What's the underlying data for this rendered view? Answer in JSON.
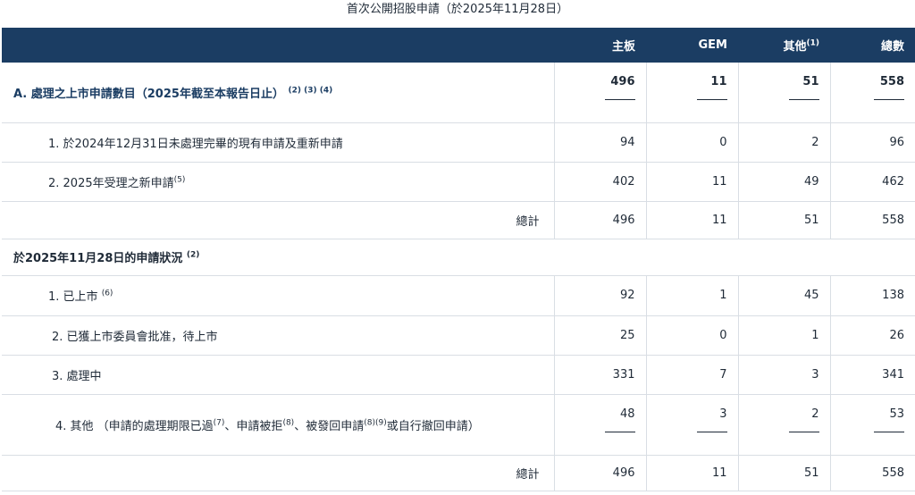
{
  "title": "首次公開招股申請（於2025年11月28日）",
  "header": {
    "col_main": "主板",
    "col_gem": "GEM",
    "col_other": "其他",
    "col_other_note": "(1)",
    "col_total": "總數"
  },
  "section_a": {
    "label": "A. 處理之上市申請數目（2025年截至本報告日止）",
    "notes": "(2) (3) (4)",
    "main": "496",
    "gem": "11",
    "other": "51",
    "total": "558"
  },
  "rows_a": [
    {
      "label": "1. 於2024年12月31日未處理完畢的現有申請及重新申請",
      "note": "",
      "main": "94",
      "gem": "0",
      "other": "2",
      "total": "96"
    },
    {
      "label": "2. 2025年受理之新申請",
      "note": "(5)",
      "main": "402",
      "gem": "11",
      "other": "49",
      "total": "462"
    }
  ],
  "total_a": {
    "label": "總計",
    "main": "496",
    "gem": "11",
    "other": "51",
    "total": "558"
  },
  "section_b": {
    "label": "於2025年11月28日的申請狀況",
    "note": "(2)"
  },
  "rows_b": [
    {
      "label": "1. 已上市",
      "note": "(6)",
      "main": "92",
      "gem": "1",
      "other": "45",
      "total": "138"
    },
    {
      "label": "2. 已獲上市委員會批准，待上市",
      "note": "",
      "main": "25",
      "gem": "0",
      "other": "1",
      "total": "26"
    },
    {
      "label": "3. 處理中",
      "note": "",
      "main": "331",
      "gem": "7",
      "other": "3",
      "total": "341"
    }
  ],
  "row_b4": {
    "label_start": "4. 其他 （申請的處理期限已過",
    "note7": "(7)",
    "part2": "、申請被拒",
    "note8a": "(8)",
    "part3": "、被發回申請",
    "note8b": "(8)",
    "note9": "(9)",
    "part4": "或自行撤回申請）",
    "main": "48",
    "gem": "3",
    "other": "2",
    "total": "53"
  },
  "total_b": {
    "label": "總計",
    "main": "496",
    "gem": "11",
    "other": "51",
    "total": "558"
  }
}
